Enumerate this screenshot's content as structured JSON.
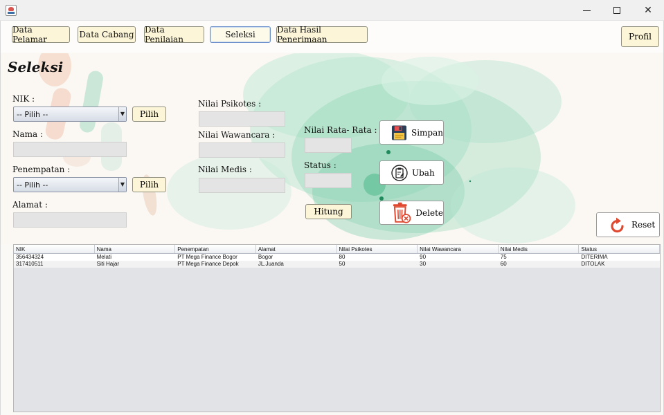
{
  "nav": {
    "items": [
      "Data Pelamar",
      "Data Cabang",
      "Data Penilaian",
      "Seleksi",
      "Data Hasil Penerimaan"
    ],
    "active": "Seleksi",
    "profil": "Profil"
  },
  "form": {
    "title": "Seleksi",
    "nik_label": "NIK :",
    "nik_value": "-- Pilih --",
    "pilih_nik": "Pilih",
    "nama_label": "Nama :",
    "penempatan_label": "Penempatan :",
    "penempatan_value": "-- Pilih --",
    "pilih_penempatan": "Pilih",
    "alamat_label": "Alamat :",
    "psikotes_label": "Nilai Psikotes :",
    "wawancara_label": "Nilai Wawancara :",
    "medis_label": "Nilai Medis :",
    "rata_label": "Nilai Rata- Rata :",
    "status_label": "Status :",
    "hitung": "Hitung",
    "simpan": "Simpan",
    "ubah": "Ubah",
    "delete": "Delete",
    "reset": "Reset"
  },
  "table": {
    "columns": [
      "NIK",
      "Nama",
      "Penempatan",
      "Alamat",
      "Nilai Psikotes",
      "Nilai Wawancara",
      "Nilai Medis",
      "Status"
    ],
    "rows": [
      [
        "356434324",
        "Melati",
        "PT Mega Finance Bogor",
        "Bogor",
        "80",
        "90",
        "75",
        "DITERIMA"
      ],
      [
        "317410511",
        "Siti Hajar",
        "PT Mega Finance Depok",
        "JL.Juanda",
        "50",
        "30",
        "60",
        "DITOLAK"
      ]
    ]
  },
  "colors": {
    "nav_button_bg": "#fcf5d7",
    "watercolor_green": "#6fc9a2",
    "accent_red": "#e0492f"
  },
  "icons": [
    "java-app-icon",
    "minimize-icon",
    "maximize-icon",
    "close-icon",
    "floppy-disk-icon",
    "clipboard-edit-icon",
    "trash-delete-icon",
    "reset-arrow-icon",
    "dropdown-arrow-icon"
  ]
}
